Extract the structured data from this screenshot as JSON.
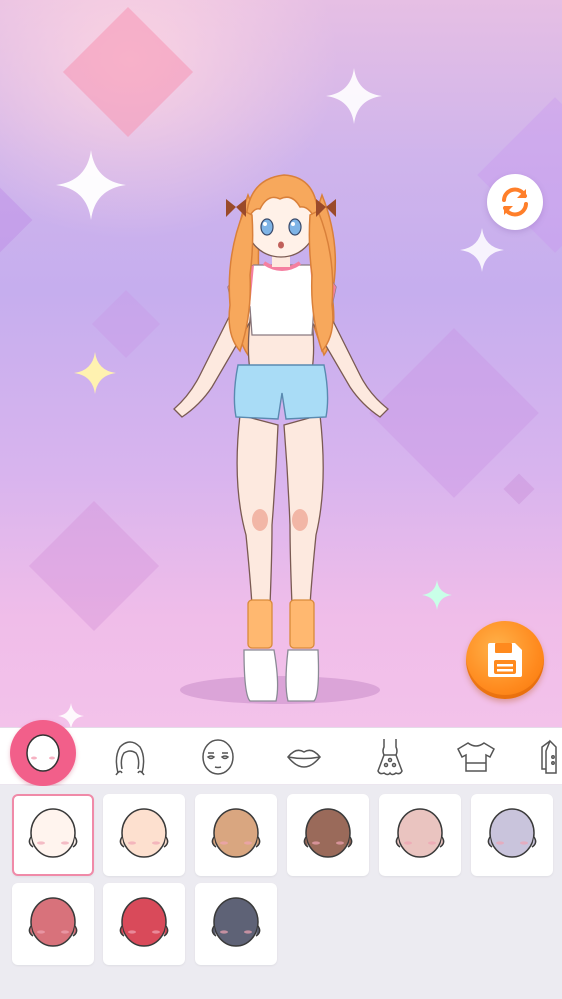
{
  "screen": "skin-tone-picker",
  "colors": {
    "accent": "#f25f8a",
    "save": "#ff8a1e",
    "selected_border": "#f08aa8"
  },
  "toolbar": {
    "rotate_icon": "rotate-icon",
    "save_icon": "floppy-disk-icon"
  },
  "tabs": [
    {
      "icon": "face-shape-icon",
      "active": true
    },
    {
      "icon": "hair-icon",
      "active": false
    },
    {
      "icon": "face-features-icon",
      "active": false
    },
    {
      "icon": "lips-icon",
      "active": false
    },
    {
      "icon": "dress-icon",
      "active": false
    },
    {
      "icon": "top-icon",
      "active": false
    },
    {
      "icon": "jacket-icon",
      "active": false
    }
  ],
  "skin_tones": [
    {
      "color": "#fff4ee",
      "selected": true
    },
    {
      "color": "#fde0cf",
      "selected": false
    },
    {
      "color": "#d9a680",
      "selected": false
    },
    {
      "color": "#9a6a5a",
      "selected": false
    },
    {
      "color": "#eac4c0",
      "selected": false
    },
    {
      "color": "#c9c4dc",
      "selected": false
    },
    {
      "color": "#d8727b",
      "selected": false
    },
    {
      "color": "#d94a5a",
      "selected": false
    },
    {
      "color": "#5e6276",
      "selected": false
    }
  ]
}
